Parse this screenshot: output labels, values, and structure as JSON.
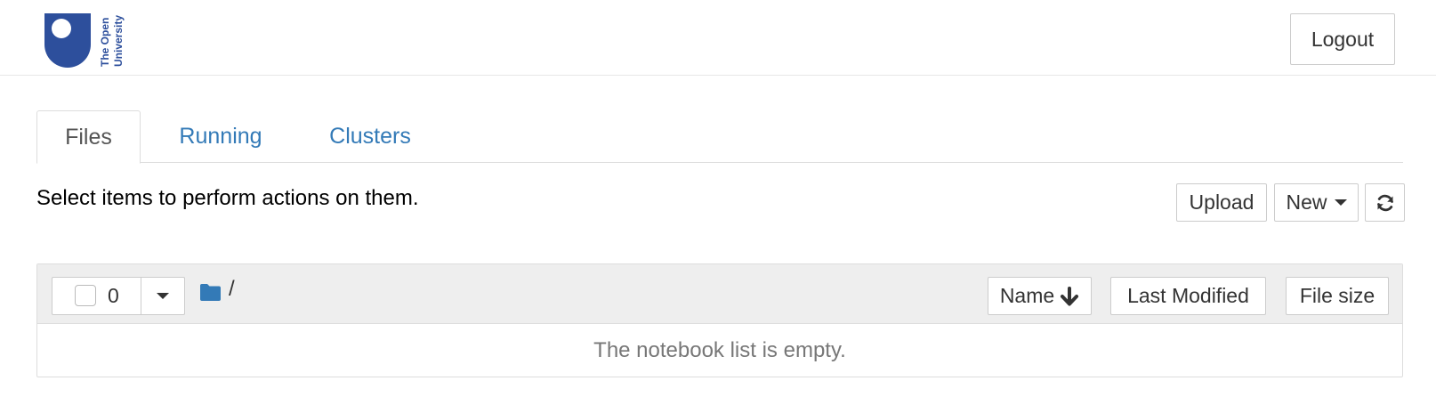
{
  "header": {
    "logo_text_line1": "The Open",
    "logo_text_line2": "University",
    "logout_label": "Logout",
    "brand_color": "#2d4f9c"
  },
  "tabs": [
    {
      "label": "Files",
      "active": true
    },
    {
      "label": "Running",
      "active": false
    },
    {
      "label": "Clusters",
      "active": false
    }
  ],
  "toolbar": {
    "hint": "Select items to perform actions on them.",
    "upload_label": "Upload",
    "new_label": "New",
    "new_icon": "caret-down-icon",
    "refresh_icon": "refresh-icon"
  },
  "file_list": {
    "selected_count": "0",
    "path": "/",
    "folder_icon": "folder-icon",
    "sort_name_label": "Name",
    "sort_name_icon": "arrow-down-icon",
    "sort_modified_label": "Last Modified",
    "sort_size_label": "File size",
    "empty_message": "The notebook list is empty."
  },
  "colors": {
    "link": "#337ab7",
    "header_bg": "#eeeeee",
    "border": "#dddddd"
  }
}
